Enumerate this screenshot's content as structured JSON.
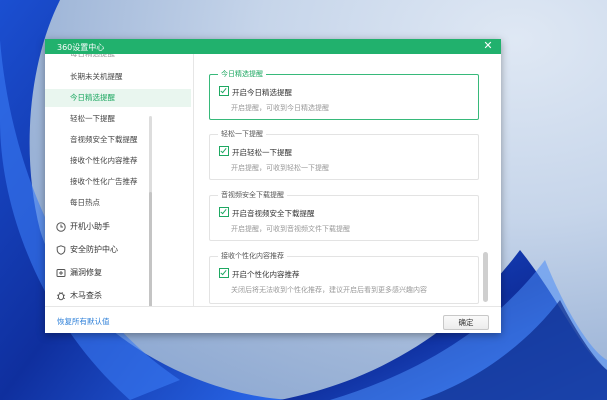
{
  "window": {
    "title": "360设置中心",
    "close_symbol": "✕"
  },
  "sidebar": {
    "top_cut_item": "每日精选提醒",
    "items": [
      {
        "label": "长期未关机提醒"
      },
      {
        "label": "今日精选提醒",
        "active": true
      },
      {
        "label": "轻松一下提醒"
      },
      {
        "label": "音视频安全下载提醒"
      },
      {
        "label": "接收个性化内容推荐"
      },
      {
        "label": "接收个性化广告推荐"
      },
      {
        "label": "每日热点"
      }
    ],
    "groups": [
      {
        "label": "开机小助手",
        "icon": "clock-icon"
      },
      {
        "label": "安全防护中心",
        "icon": "shield-icon"
      },
      {
        "label": "漏洞修复",
        "icon": "patch-icon"
      },
      {
        "label": "木马查杀",
        "icon": "bug-icon"
      }
    ]
  },
  "sections": [
    {
      "label": "今日精选提醒",
      "option": "开启今日精选提醒",
      "desc": "开启提醒，可收到今日精选提醒",
      "checked": true,
      "active": true
    },
    {
      "label": "轻松一下提醒",
      "option": "开启轻松一下提醒",
      "desc": "开启提醒，可收到轻松一下提醒",
      "checked": true
    },
    {
      "label": "音视频安全下载提醒",
      "option": "开启音视频安全下载提醒",
      "desc": "开启提醒，可收到音视频文件下载提醒",
      "checked": true
    },
    {
      "label": "接收个性化内容推荐",
      "option": "开启个性化内容推荐",
      "desc": "关闭后将无法收到个性化推荐，建议开启后看到更多感兴趣内容",
      "checked": true
    }
  ],
  "footer": {
    "restore_label": "恢复所有默认值",
    "ok_label": "确定"
  },
  "colors": {
    "accent": "#21b16d",
    "link": "#2a7ed8"
  }
}
